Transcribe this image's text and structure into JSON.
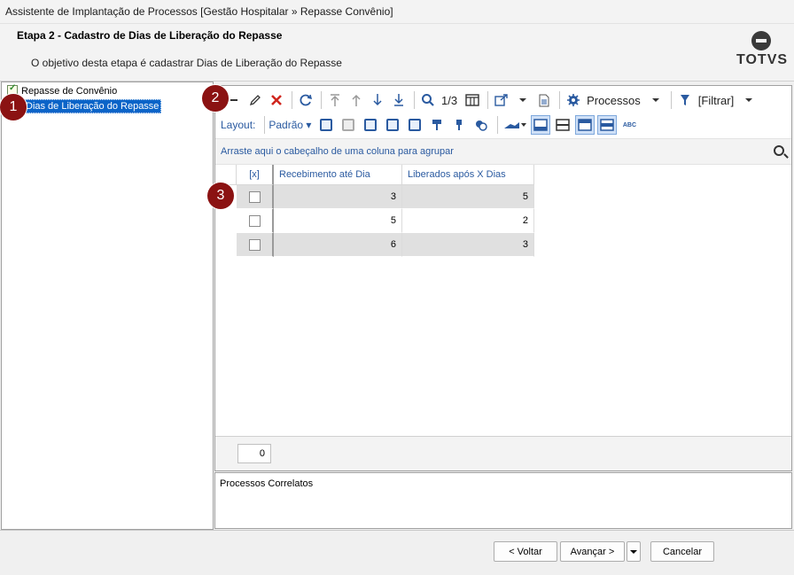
{
  "window": {
    "title": "Assistente de Implantação de Processos [Gestão Hospitalar » Repasse Convênio]"
  },
  "header": {
    "step_title": "Etapa 2 - Cadastro de Dias de Liberação do Repasse",
    "step_description": "O objetivo desta etapa é cadastrar Dias de Liberação do Repasse",
    "logo_text": "TOTVS"
  },
  "tree": {
    "root_label": "Repasse de Convênio",
    "child_label": "Dias de Liberação do Repasse"
  },
  "badges": [
    "1",
    "2",
    "3"
  ],
  "toolbar": {
    "record_counter": "1/3",
    "processos_label": "Processos",
    "filtrar_label": "[Filtrar]",
    "icons": [
      "new-icon",
      "edit-icon",
      "delete-icon",
      "refresh-icon",
      "first-icon",
      "previous-icon",
      "next-icon",
      "last-icon",
      "search-icon",
      "columns-icon",
      "export-icon",
      "report-icon",
      "gear-icon",
      "filter-icon"
    ]
  },
  "layout_bar": {
    "label": "Layout:",
    "selected": "Padrão",
    "abc_label": "ABC"
  },
  "grid": {
    "group_hint": "Arraste aqui o cabeçalho de uma coluna para agrupar",
    "columns": [
      "[x]",
      "Recebimento até Dia",
      "Liberados após X Dias"
    ],
    "rows": [
      {
        "recebimento": "3",
        "liberados": "5"
      },
      {
        "recebimento": "5",
        "liberados": "2"
      },
      {
        "recebimento": "6",
        "liberados": "3"
      }
    ],
    "footer_count": "0"
  },
  "related": {
    "label": "Processos Correlatos"
  },
  "buttons": {
    "back": "< Voltar",
    "next": "Avançar >",
    "cancel": "Cancelar"
  },
  "colors": {
    "accent": "#2a5aa0",
    "selection": "#0a64c8",
    "badge": "#8b1212",
    "delete": "#d0261e"
  }
}
